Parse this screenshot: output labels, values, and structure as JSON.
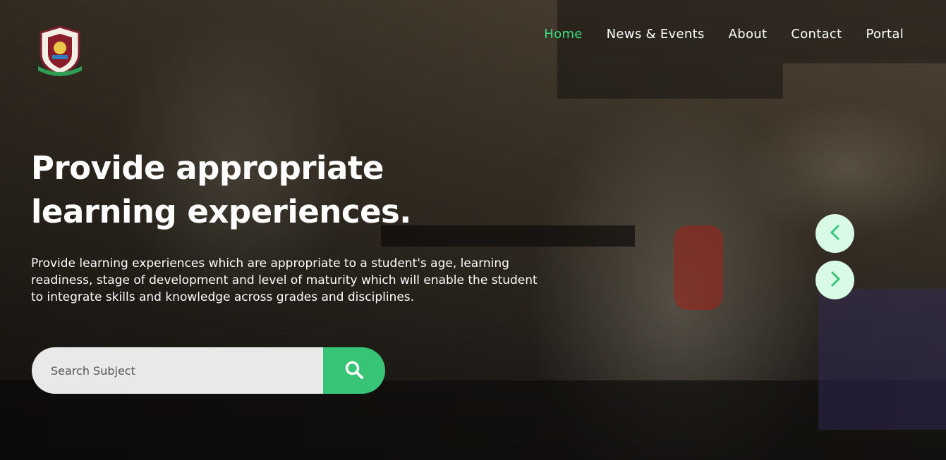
{
  "colors": {
    "accent": "#3ddc84",
    "search_button": "#37c477",
    "arrow_bg": "#d9fbe5",
    "arrow_icon": "#37c477",
    "text": "#ffffff"
  },
  "header": {
    "logo_icon": "school-crest-logo",
    "nav": [
      {
        "label": "Home",
        "active": true
      },
      {
        "label": "News & Events",
        "active": false
      },
      {
        "label": "About",
        "active": false
      },
      {
        "label": "Contact",
        "active": false
      },
      {
        "label": "Portal",
        "active": false
      }
    ]
  },
  "hero": {
    "title": "Provide appropriate learning experiences.",
    "description": "Provide learning experiences which are appropriate to a student's age, learning readiness, stage of development and level of maturity which will enable the student to integrate skills and knowledge across grades and disciplines."
  },
  "search": {
    "placeholder": "Search Subject",
    "value": "",
    "button_icon": "search-icon"
  },
  "slider": {
    "prev_icon": "chevron-left-icon",
    "next_icon": "chevron-right-icon"
  }
}
